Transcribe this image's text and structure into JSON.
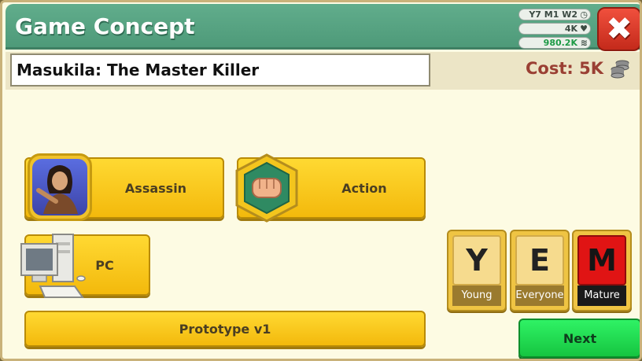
{
  "header": {
    "title": "Game Concept",
    "stats": {
      "date": "Y7 M1 W2",
      "fans": "4K",
      "money": "980.2K"
    },
    "close_icon": "close-icon"
  },
  "concept": {
    "game_name": "Masukila: The Master Killer",
    "cost": "Cost: 5K"
  },
  "selections": {
    "topic": "Assassin",
    "genre": "Action",
    "platform": "PC",
    "version": "Prototype v1"
  },
  "age_ratings": [
    {
      "letter": "Y",
      "label": "Young"
    },
    {
      "letter": "E",
      "label": "Everyone"
    },
    {
      "letter": "M",
      "label": "Mature",
      "selected": true
    }
  ],
  "actions": {
    "next": "Next"
  },
  "colors": {
    "header": "#58a584",
    "button_yellow": "#f8c81a",
    "next_green": "#22dd50",
    "cost_red": "#9a3f33",
    "money_green": "#1c9a45"
  }
}
